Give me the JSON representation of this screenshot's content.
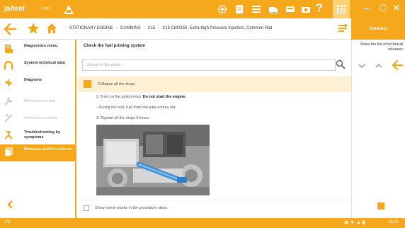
{
  "app": {
    "brand": "jaltest",
    "brand_sub": "cvm"
  },
  "nav": {
    "breadcrumbs": [
      "STATIONARY ENGINE",
      "CUMMINS",
      "X15",
      "X15 CM2350, Extra-high Pressure Injection, Common Rail"
    ],
    "connect_label": "Connect"
  },
  "sidebar": {
    "items": [
      {
        "label": "Diagnostics menu",
        "icon": "diagnostics-icon",
        "state": "normal"
      },
      {
        "label": "System technical data",
        "icon": "technical-data-icon",
        "state": "normal"
      },
      {
        "label": "Diagrams",
        "icon": "diagrams-icon",
        "state": "normal"
      },
      {
        "label": "Maintenance data",
        "icon": "maintenance-icon",
        "state": "disabled"
      },
      {
        "label": "Vehicle/vessel data",
        "icon": "vehicle-data-icon",
        "state": "disabled"
      },
      {
        "label": "Troubleshooting by symptoms",
        "icon": "troubleshooting-icon",
        "state": "normal"
      },
      {
        "label": "Releases and Procedures",
        "icon": "releases-icon",
        "state": "active"
      }
    ]
  },
  "main": {
    "title": "Check the fuel priming system",
    "search_placeholder": "Search in the guide",
    "collapse_label": "Collapse all the steps",
    "steps": {
      "step2_plain": "2. Turn on the ignition key.",
      "step2_bold": "Do not start the engine.",
      "step2_sub": "- During the test, fuel from the pipe comes out.",
      "step3": "3. Repeat all the steps 3 times."
    },
    "check_label": "Show check marks in the procedure steps."
  },
  "right_panel": {
    "label": "Show the list of technical releases"
  },
  "status": {
    "left": "1/3",
    "clock": "16:01"
  },
  "colors": {
    "accent": "#f5a81c",
    "accent_light": "#fdf0d3"
  }
}
